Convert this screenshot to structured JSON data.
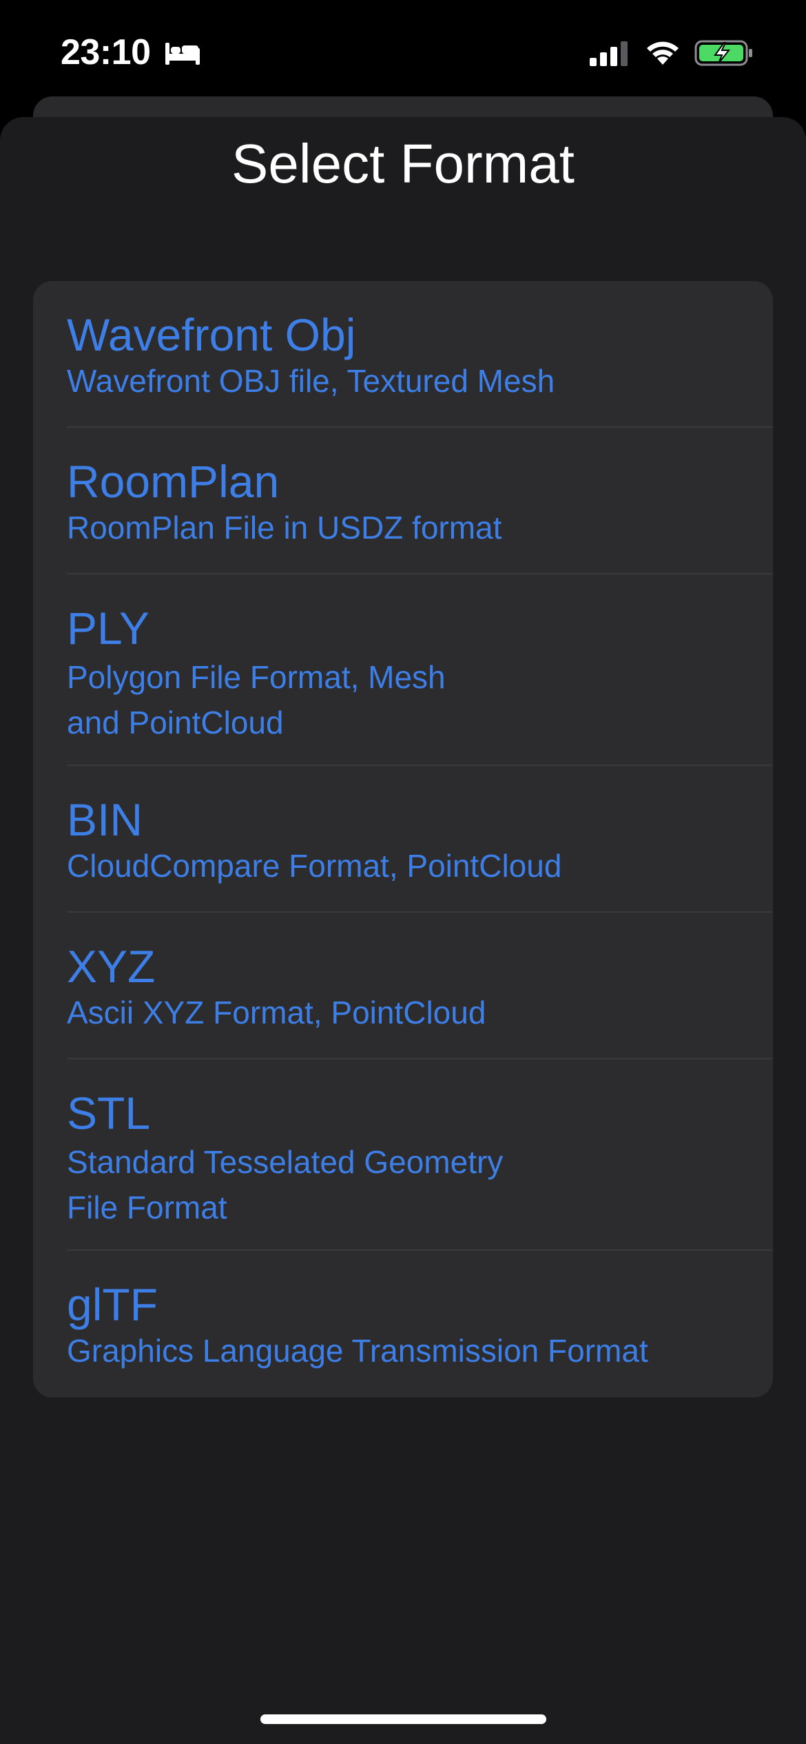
{
  "status_bar": {
    "time": "23:10",
    "sleep_icon": "bed-icon",
    "signal_icon": "cellular-signal-icon",
    "wifi_icon": "wifi-icon",
    "battery_icon": "battery-charging-icon",
    "battery_color": "#4cd964"
  },
  "sheet": {
    "title": "Select Format"
  },
  "formats": [
    {
      "name": "Wavefront Obj",
      "description": "Wavefront OBJ file, Textured Mesh"
    },
    {
      "name": "RoomPlan",
      "description": "RoomPlan File in USDZ format"
    },
    {
      "name": "PLY",
      "description": "Polygon File Format, Mesh\nand PointCloud"
    },
    {
      "name": "BIN",
      "description": "CloudCompare Format, PointCloud"
    },
    {
      "name": "XYZ",
      "description": "Ascii XYZ Format, PointCloud"
    },
    {
      "name": "STL",
      "description": "Standard Tesselated Geometry\nFile Format"
    },
    {
      "name": "glTF",
      "description": "Graphics Language Transmission Format"
    }
  ],
  "colors": {
    "accent": "#3d7fe6",
    "sheet_background": "#1c1c1e",
    "list_background": "#2c2c2e"
  }
}
